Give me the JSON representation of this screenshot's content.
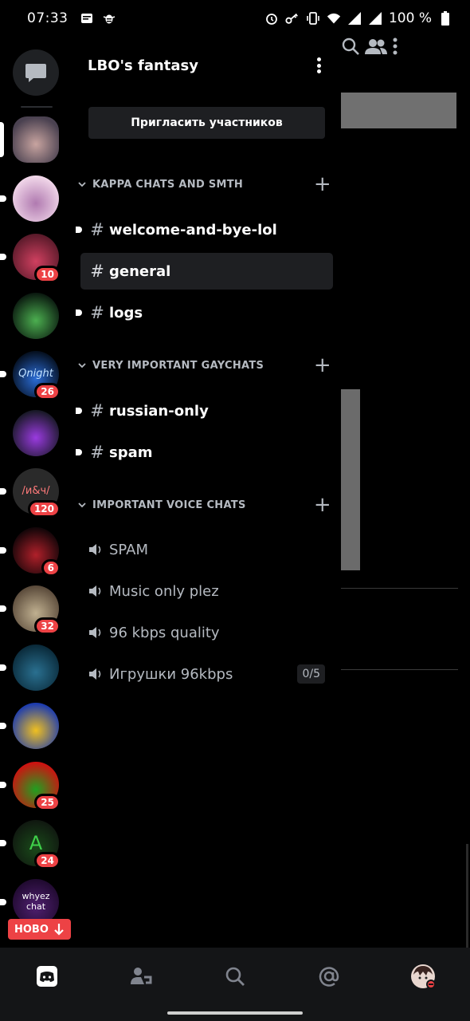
{
  "status_bar": {
    "time": "07:33",
    "battery": "100 %",
    "left_icons": [
      "message-icon",
      "bug-icon"
    ],
    "right_icons": [
      "alarm-icon",
      "key-icon",
      "vibrate-icon",
      "wifi-icon",
      "signal-icon",
      "signal-icon",
      "battery-icon"
    ]
  },
  "guild": {
    "name": "LBO's fantasy",
    "invite_label": "Пригласить участников"
  },
  "categories": [
    {
      "name": "KAPPA CHATS AND SMTH"
    },
    {
      "name": "VERY IMPORTANT GAYCHATS"
    },
    {
      "name": "IMPORTANT VOICE CHATS"
    }
  ],
  "text_channels": [
    {
      "name": "welcome-and-bye-lol",
      "unread": true
    },
    {
      "name": "general",
      "selected": true
    },
    {
      "name": "logs",
      "unread": true
    },
    {
      "name": "russian-only",
      "unread": true
    },
    {
      "name": "spam",
      "unread": true
    }
  ],
  "voice_channels": [
    {
      "name": "SPAM"
    },
    {
      "name": "Music only plez"
    },
    {
      "name": "96 kbps quality"
    },
    {
      "name": "Игрушки 96kbps",
      "count": "0/5"
    }
  ],
  "servers": [
    {
      "avatar_text": "",
      "badge": "",
      "colors": [
        "#4a4150",
        "#c8a4a0"
      ]
    },
    {
      "avatar_text": "",
      "badge": "",
      "colors": [
        "#f2d8ea",
        "#b07ab0"
      ]
    },
    {
      "avatar_text": "",
      "badge": "10",
      "colors": [
        "#5a1a2a",
        "#d04060"
      ]
    },
    {
      "avatar_text": "",
      "badge": "",
      "colors": [
        "#0b1a10",
        "#4caf50"
      ]
    },
    {
      "avatar_text": "Qnight",
      "badge": "26",
      "colors": [
        "#051020",
        "#2b6cd6"
      ]
    },
    {
      "avatar_text": "",
      "badge": "",
      "colors": [
        "#181826",
        "#9a3be0"
      ]
    },
    {
      "avatar_text": "/и&ч/",
      "badge": "120",
      "colors": [
        "#2a2a2a",
        "#2a2a2a"
      ]
    },
    {
      "avatar_text": "",
      "badge": "6",
      "colors": [
        "#120508",
        "#b0202a"
      ]
    },
    {
      "avatar_text": "",
      "badge": "32",
      "colors": [
        "#5a4a3a",
        "#c0b090"
      ]
    },
    {
      "avatar_text": "",
      "badge": "",
      "colors": [
        "#0a2a3a",
        "#2a7090"
      ]
    },
    {
      "avatar_text": "",
      "badge": "",
      "colors": [
        "#1a3ab0",
        "#f0c020"
      ]
    },
    {
      "avatar_text": "",
      "badge": "25",
      "colors": [
        "#d01010",
        "#20a020"
      ]
    },
    {
      "avatar_text": "A",
      "badge": "24",
      "colors": [
        "#101810",
        "#1a4a1a"
      ]
    },
    {
      "avatar_text": "whyez chat",
      "badge": "",
      "colors": [
        "#200a30",
        "#502070"
      ]
    }
  ],
  "new_pill_label": "НОВО",
  "bottom_nav": [
    "discord-home-icon",
    "friends-icon",
    "search-icon",
    "mentions-icon",
    "profile-avatar"
  ],
  "colors": {
    "accent_red": "#ed4245",
    "panel": "#1e1f22",
    "muted": "#b5bac1"
  }
}
